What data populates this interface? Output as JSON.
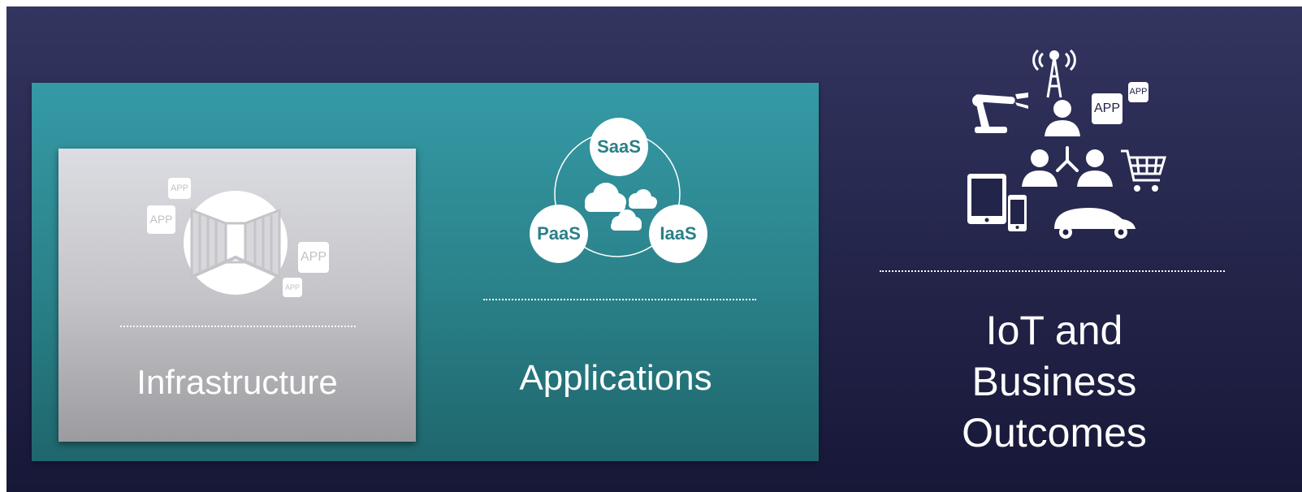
{
  "slide": {
    "infrastructure": {
      "title": "Infrastructure",
      "app_badges": [
        "APP",
        "APP",
        "APP",
        "APP"
      ]
    },
    "applications": {
      "title": "Applications",
      "services": [
        "SaaS",
        "PaaS",
        "IaaS"
      ]
    },
    "iot": {
      "title_lines": [
        "IoT and",
        "Business",
        "Outcomes"
      ],
      "app_badges": [
        "APP",
        "APP"
      ]
    }
  },
  "colors": {
    "background_top": "#333560",
    "background_bottom": "#171838",
    "teal_panel": "#2a8189",
    "gray_panel": "#c4c4c9",
    "accent_text": "#2a7f88"
  }
}
